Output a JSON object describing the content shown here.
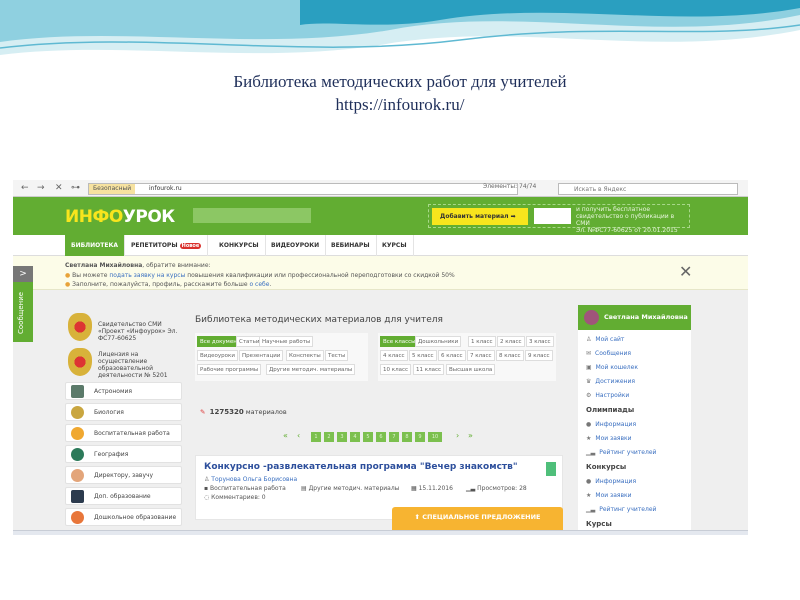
{
  "slide": {
    "title": "Библиотека методических работ для учителей",
    "url": "https://infourok.ru/"
  },
  "browser": {
    "back": "←",
    "forward": "→",
    "stop": "✕",
    "key": "⊶",
    "security_label": "Безопасный",
    "address": "infourok.ru",
    "find_label": "Элементы:",
    "find_count": "74/74",
    "search_placeholder": "Искать в Яндекс"
  },
  "header": {
    "logo_a": "ИНФО",
    "logo_b": "УРОК",
    "add_material": "Добавить материал ➡",
    "promo_text": [
      "и получить бесплатное",
      "свидетельство о публикации в СМИ",
      "Эл. №ФС77-60625 от 20.01.2015"
    ]
  },
  "nav": {
    "items": [
      "БИБЛИОТЕКА",
      "РЕПЕТИТОРЫ",
      "КОНКУРСЫ",
      "ВИДЕОУРОКИ",
      "ВЕБИНАРЫ",
      "КУРСЫ"
    ],
    "badge": "Новое"
  },
  "notice": {
    "name": "Светлана Михайловна",
    "intro": ", обратите внимание:",
    "line1_a": "Вы можете ",
    "line1_link": "подать заявку на курсы",
    "line1_b": " повышения квалификации или профессиональной переподготовки со скидкой 50%",
    "line2_a": "Заполните, пожалуйста, профиль, расскажите больше ",
    "line2_link": "о себе",
    "line2_b": "."
  },
  "side_tab": {
    "arrow": ">",
    "label": "Сообщение"
  },
  "left": {
    "cert1": [
      "Свидетельство СМИ",
      "«Проект «Инфоурок» Эл.",
      "ФС77-60625"
    ],
    "cert2": [
      "Лицензия на",
      "осуществление",
      "образовательной",
      "деятельности № 5201"
    ],
    "categories": [
      "Астрономия",
      "Биология",
      "Воспитательная работа",
      "География",
      "Директору, завучу",
      "Доп. образование",
      "Дошкольное образование"
    ]
  },
  "library": {
    "title": "Библиотека методических материалов для учителя",
    "types": [
      "Все документы",
      "Статьи",
      "Научные работы",
      "Видеоуроки",
      "Презентации",
      "Конспекты",
      "Тесты",
      "Рабочие программы",
      "Другие методич. материалы"
    ],
    "classes": [
      "Все классы",
      "Дошкольники",
      "1 класс",
      "2 класс",
      "3 класс",
      "4 класс",
      "5 класс",
      "6 класс",
      "7 класс",
      "8 класс",
      "9 класс",
      "10 класс",
      "11 класс",
      "Высшая школа"
    ],
    "count": "1275320",
    "count_label": " материалов",
    "pager": {
      "first": "«",
      "prev": "‹",
      "next": "›",
      "last": "»",
      "pages": [
        "1",
        "2",
        "3",
        "4",
        "5",
        "6",
        "7",
        "8",
        "9",
        "10"
      ]
    }
  },
  "card": {
    "title": "Конкурсно -развлекательная программа \"Вечер знакомств\"",
    "author": "Торунова Ольга Борисовна",
    "category": "Воспитательная работа",
    "type": "Другие методич. материалы",
    "date": "15.11.2016",
    "views": "Просмотров: 28",
    "comments": "Комментариев: 0"
  },
  "special_offer": "СПЕЦИАЛЬНОЕ ПРЕДЛОЖЕНИЕ",
  "profile": {
    "name": "Светлана Михайловна",
    "links": [
      "Мой сайт",
      "Сообщения",
      "Мой кошелек",
      "Достижения",
      "Настройки"
    ],
    "olympiads": {
      "title": "Олимпиады",
      "links": [
        "Информация",
        "Мои заявки",
        "Рейтинг учителей"
      ]
    },
    "contests": {
      "title": "Конкурсы",
      "links": [
        "Информация",
        "Мои заявки",
        "Рейтинг учителей"
      ]
    },
    "courses": {
      "title": "Курсы"
    }
  },
  "colors": {
    "green": "#62ad32",
    "yellow": "#f8e51d",
    "orange": "#f7b431",
    "link": "#3a6fc0"
  }
}
